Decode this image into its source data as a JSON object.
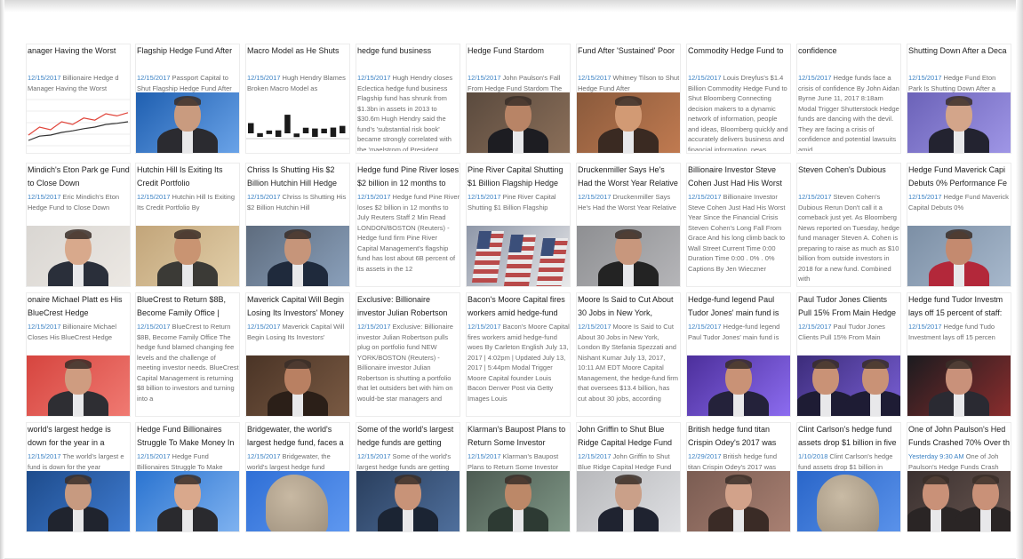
{
  "cards": [
    [
      {
        "title": "anager Having the Worst",
        "date": "12/15/2017",
        "snippet": "Billionaire Hedge d Manager Having the Worst",
        "thumb": "line-chart"
      },
      {
        "title": "Flagship Hedge Fund After",
        "date": "12/15/2017",
        "snippet": "Passport Capital to Shut Flagship Hedge Fund After",
        "thumb": "portrait-blue"
      },
      {
        "title": "Macro Model as He Shuts",
        "date": "12/15/2017",
        "snippet": "Hugh Hendry Blames Broken Macro Model as",
        "thumb": "bar-chart"
      },
      {
        "title": "hedge fund business",
        "date": "12/15/2017",
        "snippet": "Hugh Hendry closes Eclectica hedge fund business Flagship fund has shrunk from $1.3bn in assets in 2013 to $30.6m Hugh Hendry said the fund's 'substantial risk book' became strongly correlated with the 'maelstrom of President",
        "thumb": "none"
      },
      {
        "title": "Hedge Fund Stardom",
        "date": "12/15/2017",
        "snippet": "John Paulson's Fall From Hedge Fund Stardom The",
        "thumb": "portrait-crowd"
      },
      {
        "title": "Fund After 'Sustained' Poor",
        "date": "12/15/2017",
        "snippet": "Whitney Tilson to Shut Hedge Fund After",
        "thumb": "portrait-warm"
      },
      {
        "title": "Commodity Hedge Fund to",
        "date": "12/15/2017",
        "snippet": "Louis Dreyfus's $1.4 Billion Commodity Hedge Fund to Shut Bloomberg Connecting decision makers to a dynamic network of information, people and ideas, Bloomberg quickly and accurately delivers business and financial information, news",
        "thumb": "none"
      },
      {
        "title": "confidence",
        "date": "12/15/2017",
        "snippet": "Hedge funds face a crisis of confidence By John Aidan Byrne June 11, 2017 8:18am Modal Trigger Shutterstock Hedge funds are dancing with the devil. They are facing a crisis of confidence and potential lawsuits amid",
        "thumb": "none"
      },
      {
        "title": "Shutting Down After a Deca",
        "date": "12/15/2017",
        "snippet": "Hedge Fund Eton Park Is Shutting Down After a",
        "thumb": "portrait-stage"
      }
    ],
    [
      {
        "title": "Mindich's Eton Park ge Fund to Close Down",
        "date": "12/15/2017",
        "snippet": "Eric Mindich's Eton Hedge Fund to Close Down",
        "thumb": "portrait-pale"
      },
      {
        "title": "Hutchin Hill Is Exiting Its Credit Portfolio",
        "date": "12/15/2017",
        "snippet": "Hutchin Hill Is Exiting Its Credit Portfolio By",
        "thumb": "portrait-glasses"
      },
      {
        "title": "Chriss Is Shutting His $2 Billion Hutchin Hill Hedge",
        "date": "12/15/2017",
        "snippet": "Chriss Is Shutting His $2 Billion Hutchin Hill",
        "thumb": "portrait-office"
      },
      {
        "title": "Hedge fund Pine River loses $2 billion in 12 months to July",
        "date": "12/15/2017",
        "snippet": "Hedge fund Pine River loses $2 billion in 12 months to July Reuters Staff 2 Min Read LONDON/BOSTON (Reuters) - Hedge fund firm Pine River Capital Management's flagship fund has lost about 6B percent of its assets in the 12",
        "thumb": "none"
      },
      {
        "title": "Pine River Capital Shutting $1 Billion Flagship Hedge Fund",
        "date": "12/15/2017",
        "snippet": "Pine River Capital Shutting $1 Billion Flagship",
        "thumb": "flags"
      },
      {
        "title": "Druckenmiller Says He's Had the Worst Year Relative to the",
        "date": "12/15/2017",
        "snippet": "Druckenmiller Says He's Had the Worst Year Relative",
        "thumb": "portrait-grey"
      },
      {
        "title": "Billionaire Investor Steve Cohen Just Had His Worst",
        "date": "12/15/2017",
        "snippet": "Billionaire Investor Steve Cohen Just Had His Worst Year Since the Financial Crisis Steven Cohen's Long Fall From Grace And his long climb back to Wall Street Current Time 0:00 Duration Time 0:00 . 0% . 0% Captions By Jen Wieczner",
        "thumb": "none"
      },
      {
        "title": "Steven Cohen's Dubious",
        "date": "12/15/2017",
        "snippet": "Steven Cohen's Dubious Rerun Don't call it a comeback just yet. As Bloomberg News reported on Tuesday, hedge fund manager Steven A. Cohen is preparing to raise as much as $10 billion from outside investors in 2018 for a new fund. Combined with",
        "thumb": "none"
      },
      {
        "title": "Hedge Fund Maverick Capi Debuts 0% Performance Fe",
        "date": "12/15/2017",
        "snippet": "Hedge Fund Maverick Capital Debuts 0%",
        "thumb": "portrait-red"
      }
    ],
    [
      {
        "title": "onaire Michael Platt es His BlueCrest Hedge",
        "date": "12/15/2017",
        "snippet": "Billionaire Michael Closes His BlueCrest Hedge",
        "thumb": "portrait-redbg"
      },
      {
        "title": "BlueCrest to Return $8B, Become Family Office | Chief",
        "date": "12/15/2017",
        "snippet": "BlueCrest to Return $8B, Become Family Office The hedge fund blamed changing fee levels and the challenge of meeting investor needs. BlueCrest Capital Management is returning $8 billion to investors and turning into a",
        "thumb": "none"
      },
      {
        "title": "Maverick Capital Will Begin Losing Its Investors' Money",
        "date": "12/15/2017",
        "snippet": "Maverick Capital Will Begin Losing Its Investors'",
        "thumb": "portrait-dark"
      },
      {
        "title": "Exclusive: Billionaire investor Julian Robertson pulls plug on",
        "date": "12/15/2017",
        "snippet": "Exclusive: Billionaire investor Julian Robertson pulls plug on portfolio fund NEW YORK/BOSTON (Reuters) - Billionaire investor Julian Robertson is shutting a portfolio that let outsiders bet with him on would-be star managers and",
        "thumb": "none"
      },
      {
        "title": "Bacon's Moore Capital fires workers amid hedge-fund",
        "date": "12/15/2017",
        "snippet": "Bacon's Moore Capital fires workers amid hedge-fund woes By Carleton English July 13, 2017 | 4:02pm | Updated July 13, 2017 | 5:44pm Modal Trigger Moore Capital founder Louis Bacon Denver Post via Getty Images Louis",
        "thumb": "none"
      },
      {
        "title": "Moore Is Said to Cut About 30 Jobs in New York, London",
        "date": "12/15/2017",
        "snippet": "Moore Is Said to Cut About 30 Jobs in New York, London By Stefania Spezzati and Nishant Kumar July 13, 2017, 10:11 AM EDT Moore Capital Management, the hedge-fund firm that oversees $13.4 billion, has cut about 30 jobs, according",
        "thumb": "none"
      },
      {
        "title": "Hedge-fund legend Paul Tudor Jones' main fund is",
        "date": "12/15/2017",
        "snippet": "Hedge-fund legend Paul Tudor Jones' main fund is",
        "thumb": "portrait-purple"
      },
      {
        "title": "Paul Tudor Jones Clients Pull 15% From Main Hedge Fund",
        "date": "12/15/2017",
        "snippet": "Paul Tudor Jones Clients Pull 15% From Main",
        "thumb": "portrait-purple2"
      },
      {
        "title": "Hedge fund Tudor Investm lays off 15 percent of staff:",
        "date": "12/15/2017",
        "snippet": "Hedge fund Tudo Investment lays off 15 percen",
        "thumb": "portrait-podium"
      }
    ],
    [
      {
        "title": "world's largest hedge is down for the year in a",
        "date": "12/15/2017",
        "snippet": "The world's largest e fund is down for the year",
        "thumb": "portrait-navy"
      },
      {
        "title": "Hedge Fund Billionaires Struggle To Make Money In",
        "date": "12/15/2017",
        "snippet": "Hedge Fund Billionaires Struggle To Make",
        "thumb": "portrait-bluebg"
      },
      {
        "title": "Bridgewater, the world's largest hedge fund, faces a",
        "date": "12/15/2017",
        "snippet": "Bridgewater, the world's largest hedge fund",
        "thumb": "sculpture"
      },
      {
        "title": "Some of the world's largest hedge funds are getting",
        "date": "12/15/2017",
        "snippet": "Some of the world's largest hedge funds are getting",
        "thumb": "portrait-navy2"
      },
      {
        "title": "Klarman's Baupost Plans to Return Some Investor Money",
        "date": "12/15/2017",
        "snippet": "Klarman's Baupost Plans to Return Some Investor",
        "thumb": "portrait-phone"
      },
      {
        "title": "John Griffin to Shut Blue Ridge Capital Hedge Fund",
        "date": "12/15/2017",
        "snippet": "John Griffin to Shut Blue Ridge Capital Hedge Fund",
        "thumb": "portrait-suit"
      },
      {
        "title": "British hedge fund titan Crispin Odey's 2017 was even",
        "date": "12/29/2017",
        "snippet": "British hedge fund titan Crispin Odey's 2017 was",
        "thumb": "portrait-closeup"
      },
      {
        "title": "Clint Carlson's hedge fund assets drop $1 billion in five",
        "date": "1/10/2018",
        "snippet": "Clint Carlson's hedge fund assets drop $1 billion in",
        "thumb": "sculpture2"
      },
      {
        "title": "One of John Paulson's Hed Funds Crashed 70% Over th",
        "date": "Yesterday 9:30 AM",
        "snippet": "One of Joh Paulson's Hedge Funds Crash",
        "thumb": "portrait-duo"
      }
    ]
  ],
  "line_chart": {
    "series": [
      [
        0.3,
        0.45,
        0.4,
        0.55,
        0.5,
        0.62,
        0.58,
        0.7,
        0.66,
        0.72
      ],
      [
        0.2,
        0.28,
        0.3,
        0.35,
        0.38,
        0.42,
        0.45,
        0.5,
        0.52,
        0.55
      ]
    ]
  },
  "bar_chart": {
    "values": [
      0.55,
      0.2,
      0.15,
      0.35,
      1.0,
      0.18,
      0.3,
      0.45,
      0.25,
      0.5,
      0.4
    ]
  }
}
